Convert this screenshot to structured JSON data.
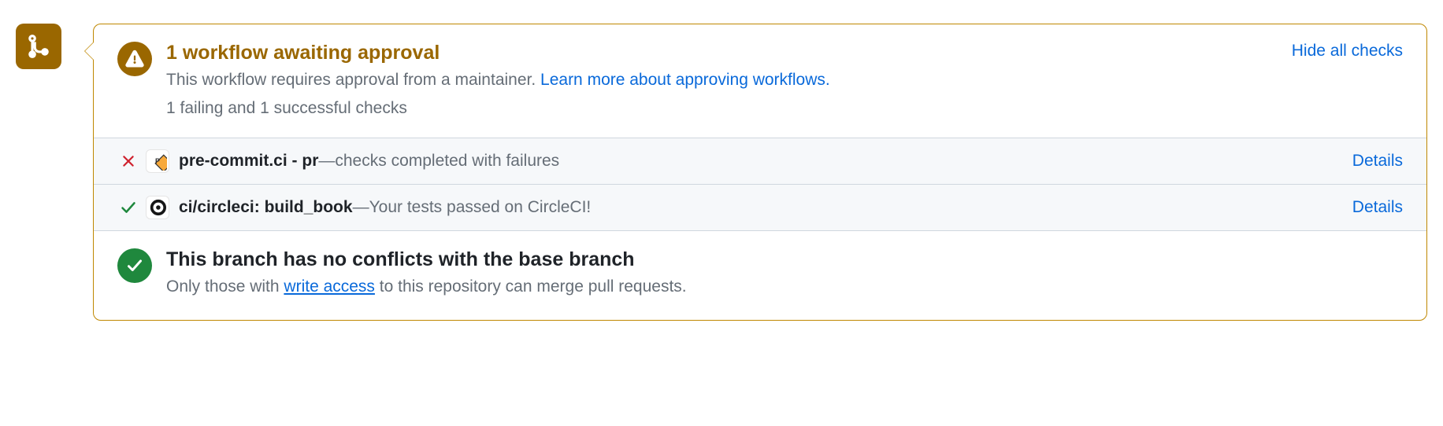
{
  "header": {
    "title": "1 workflow awaiting approval",
    "subtitle_prefix": "This workflow requires approval from a maintainer. ",
    "learn_more": "Learn more about approving workflows.",
    "checks_summary": "1 failing and 1 successful checks",
    "toggle_label": "Hide all checks"
  },
  "checks": [
    {
      "status": "fail",
      "avatar": "precommit",
      "name": "pre-commit.ci - pr",
      "sep": " — ",
      "desc": "checks completed with failures",
      "action": "Details"
    },
    {
      "status": "pass",
      "avatar": "circleci",
      "name": "ci/circleci: build_book",
      "sep": " — ",
      "desc": "Your tests passed on CircleCI!",
      "action": "Details"
    }
  ],
  "merge": {
    "title": "This branch has no conflicts with the base branch",
    "sub_prefix": "Only those with ",
    "write_access": "write access",
    "sub_suffix": " to this repository can merge pull requests."
  }
}
